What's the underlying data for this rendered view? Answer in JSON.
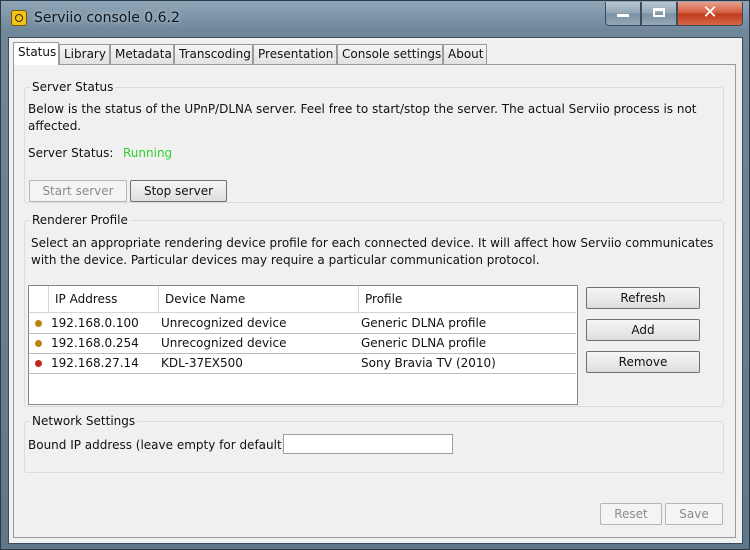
{
  "window": {
    "title": "Serviio console 0.6.2",
    "icon": "serviio-app-icon"
  },
  "tabs": [
    {
      "label": "Status",
      "active": true
    },
    {
      "label": "Library",
      "active": false
    },
    {
      "label": "Metadata",
      "active": false
    },
    {
      "label": "Transcoding",
      "active": false
    },
    {
      "label": "Presentation",
      "active": false
    },
    {
      "label": "Console settings",
      "active": false
    },
    {
      "label": "About",
      "active": false
    }
  ],
  "server_status": {
    "group_title": "Server Status",
    "description": "Below is the status of the UPnP/DLNA server. Feel free to start/stop the server. The actual Serviio process is not affected.",
    "status_label": "Server Status:",
    "status_value": "Running",
    "status_color": "#2fd12f",
    "start_label": "Start server",
    "stop_label": "Stop server"
  },
  "renderer_profile": {
    "group_title": "Renderer Profile",
    "description": "Select an appropriate rendering device profile for each connected device. It will affect how Serviio communicates with the device. Particular devices may require a particular communication protocol.",
    "columns": [
      "IP Address",
      "Device Name",
      "Profile"
    ],
    "rows": [
      {
        "status_color": "#b8860b",
        "ip": "192.168.0.100",
        "device": "Unrecognized device",
        "profile": "Generic DLNA profile"
      },
      {
        "status_color": "#b8860b",
        "ip": "192.168.0.254",
        "device": "Unrecognized device",
        "profile": "Generic DLNA profile"
      },
      {
        "status_color": "#c0281e",
        "ip": "192.168.27.14",
        "device": "KDL-37EX500",
        "profile": "Sony Bravia TV (2010)"
      }
    ],
    "refresh_label": "Refresh",
    "add_label": "Add",
    "remove_label": "Remove"
  },
  "network_settings": {
    "group_title": "Network Settings",
    "bound_ip_label": "Bound IP address (leave empty for default):",
    "bound_ip_value": ""
  },
  "footer": {
    "reset_label": "Reset",
    "save_label": "Save"
  }
}
